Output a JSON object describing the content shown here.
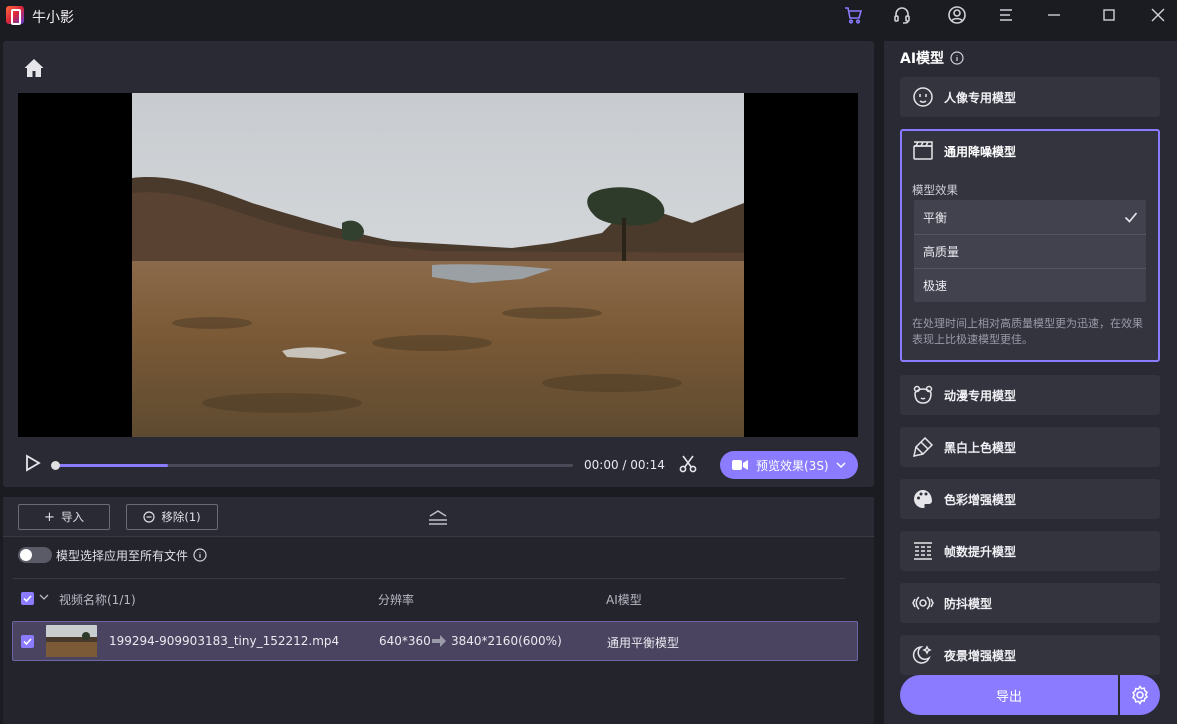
{
  "app": {
    "title": "牛小影"
  },
  "titlebar_icons": [
    "cart-icon",
    "headset-icon",
    "user-icon",
    "menu-icon",
    "minimize-icon",
    "maximize-icon",
    "close-icon"
  ],
  "player": {
    "time": "00:00 / 00:14",
    "progress_fraction": 0.22,
    "preview_button": "预览效果(3S)"
  },
  "file_panel": {
    "import_button": "导入",
    "remove_button": "移除(1)",
    "toggle_label": "模型选择应用至所有文件",
    "toggle_on": false,
    "columns": {
      "name": "视频名称(1/1)",
      "resolution": "分辨率",
      "model": "AI模型"
    },
    "rows": [
      {
        "filename": "199294-909903183_tiny_152212.mp4",
        "resolution_from": "640*360",
        "resolution_to": "3840*2160(600%)",
        "model": "通用平衡模型",
        "checked": true
      }
    ]
  },
  "side": {
    "title": "AI模型",
    "models": {
      "portrait": "人像专用模型",
      "general": "通用降噪模型",
      "anime": "动漫专用模型",
      "colorize": "黑白上色模型",
      "color_enhance": "色彩增强模型",
      "frame": "帧数提升模型",
      "stabilize": "防抖模型",
      "night": "夜景增强模型"
    },
    "effect_label": "模型效果",
    "options": [
      "平衡",
      "高质量",
      "极速"
    ],
    "selected_option": "平衡",
    "description": "在处理时间上相对高质量模型更为迅速，在效果表现上比极速模型更佳。",
    "export_button": "导出"
  },
  "colors": {
    "accent": "#8a7bff",
    "panel": "#2a2a35",
    "background": "#1b1b22",
    "selected_row": "#4a4460"
  }
}
